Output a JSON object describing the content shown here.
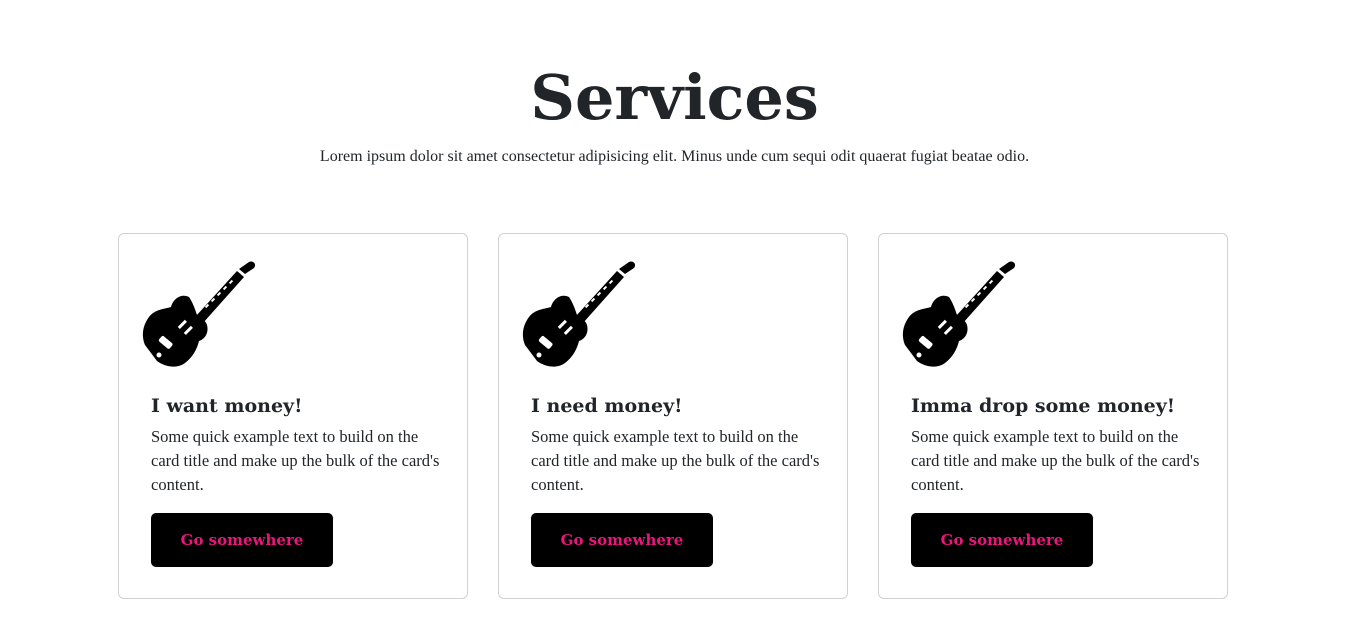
{
  "header": {
    "title": "Services",
    "subtitle": "Lorem ipsum dolor sit amet consectetur adipisicing elit. Minus unde cum sequi odit quaerat fugiat beatae odio."
  },
  "cards": [
    {
      "icon": "guitar-icon",
      "title": "I want money!",
      "text": "Some quick example text to build on the card title and make up the bulk of the card's content.",
      "button_label": "Go somewhere"
    },
    {
      "icon": "guitar-icon",
      "title": "I need money!",
      "text": "Some quick example text to build on the card title and make up the bulk of the card's content.",
      "button_label": "Go somewhere"
    },
    {
      "icon": "guitar-icon",
      "title": "Imma drop some money!",
      "text": "Some quick example text to build on the card title and make up the bulk of the card's content.",
      "button_label": "Go somewhere"
    }
  ],
  "colors": {
    "text": "#212529",
    "button_bg": "#000000",
    "button_text": "#e8177d",
    "card_border": "#d9d9d9"
  }
}
